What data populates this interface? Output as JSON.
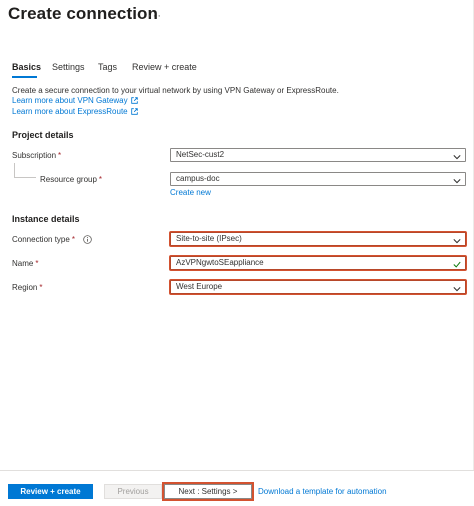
{
  "header": {
    "title": "Create connection",
    "more": "···"
  },
  "tabs": [
    {
      "label": "Basics",
      "active": true
    },
    {
      "label": "Settings",
      "active": false
    },
    {
      "label": "Tags",
      "active": false
    },
    {
      "label": "Review + create",
      "active": false
    }
  ],
  "intro": {
    "description": "Create a secure connection to your virtual network by using VPN Gateway or ExpressRoute.",
    "link_vpn": "Learn more about VPN Gateway",
    "link_expressroute": "Learn more about ExpressRoute"
  },
  "project_details": {
    "heading": "Project details",
    "subscription_label": "Subscription",
    "subscription_value": "NetSec-cust2",
    "resource_group_label": "Resource group",
    "resource_group_value": "campus-doc",
    "create_new": "Create new"
  },
  "instance_details": {
    "heading": "Instance details",
    "connection_type_label": "Connection type",
    "connection_type_value": "Site-to-site (IPsec)",
    "name_label": "Name",
    "name_value": "AzVPNgwtoSEappliance",
    "region_label": "Region",
    "region_value": "West Europe"
  },
  "required_marker": "*",
  "footer": {
    "review_create": "Review + create",
    "previous": "Previous",
    "next": "Next : Settings >",
    "download_template": "Download a template for automation"
  },
  "colors": {
    "accent": "#0078d4",
    "highlight": "#d35230",
    "required": "#a4262c",
    "success": "#107c10"
  },
  "icons": {
    "external_link": "external-link-icon",
    "chevron": "chevron-down-icon",
    "check": "checkmark-icon",
    "info": "info-icon"
  }
}
